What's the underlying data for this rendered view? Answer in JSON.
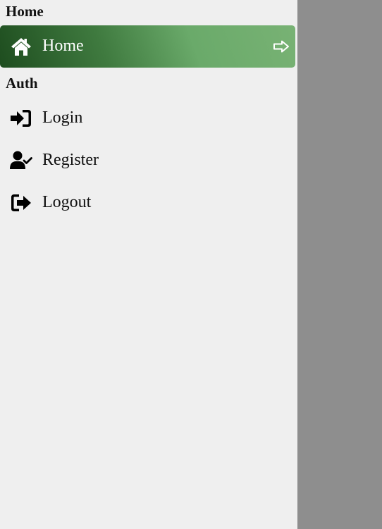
{
  "sections": [
    {
      "title": "Home"
    },
    {
      "title": "Auth"
    }
  ],
  "menu": {
    "home": {
      "label": "Home",
      "icon": "home-icon",
      "active": true
    },
    "login": {
      "label": "Login",
      "icon": "login-icon"
    },
    "register": {
      "label": "Register",
      "icon": "user-check-icon"
    },
    "logout": {
      "label": "Logout",
      "icon": "logout-icon"
    }
  },
  "colors": {
    "drawer_background": "#efefef",
    "overlay": "#8e8e8e",
    "active_gradient_start": "#1e4d1f",
    "active_gradient_end": "#78b274",
    "active_text": "#ffffff"
  }
}
